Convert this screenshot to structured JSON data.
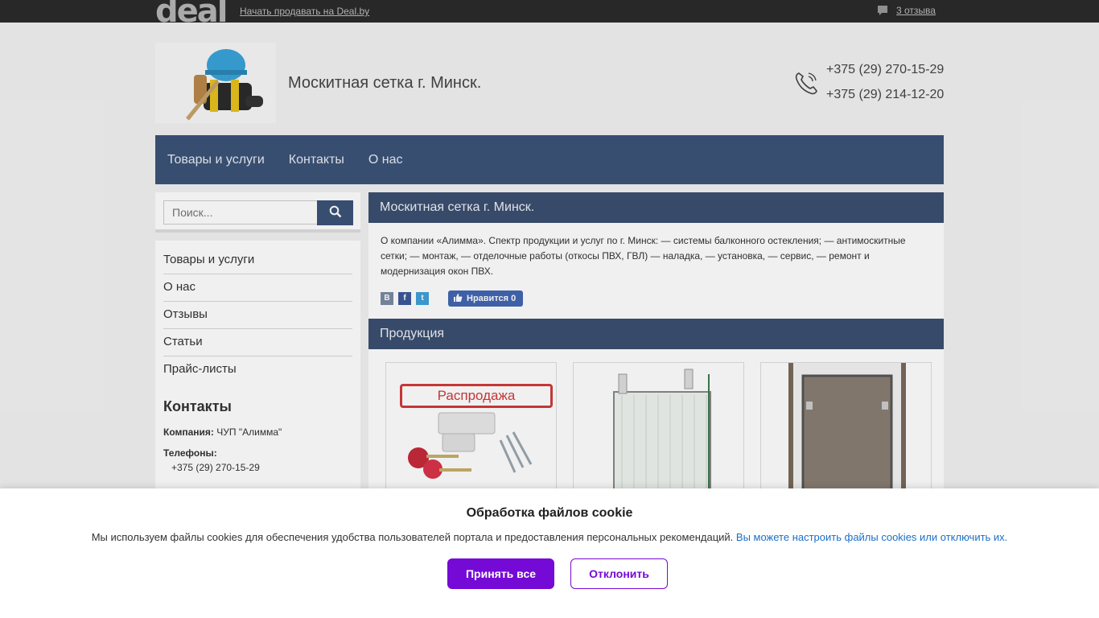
{
  "topbar": {
    "logo_text": "deal",
    "sell_link": "Начать продавать на Deal.by",
    "reviews_link": "3 отзыва"
  },
  "header": {
    "title": "Москитная сетка г. Минск.",
    "phones": [
      "+375 (29) 270-15-29",
      "+375 (29) 214-12-20"
    ]
  },
  "nav": {
    "items": [
      "Товары и услуги",
      "Контакты",
      "О нас"
    ]
  },
  "search": {
    "placeholder": "Поиск..."
  },
  "sidebar": {
    "menu": [
      "Товары и услуги",
      "О нас",
      "Отзывы",
      "Статьи",
      "Прайс-листы"
    ],
    "contacts_heading": "Контакты",
    "company_label": "Компания:",
    "company_value": "ЧУП \"Алимма\"",
    "phones_label": "Телефоны:",
    "phones_value": "+375 (29) 270-15-29"
  },
  "main": {
    "section_title": "Москитная сетка г. Минск.",
    "about": "О компании «Алимма». Спектр продукции и услуг по г. Минск: — системы балконного остекления; — антимоскитные сетки; — монтаж, — отделочные работы (откосы ПВХ, ГВЛ) — наладка, — установка, — сервис, — ремонт и модернизация окон ПВХ.",
    "social": {
      "vk": "B",
      "fb": "f",
      "tw": "t"
    },
    "like_label": "Нравится 0",
    "products_title": "Продукция",
    "product1_label": "Распродажа"
  },
  "cookie": {
    "title": "Обработка файлов cookie",
    "text": "Мы используем файлы cookies для обеспечения удобства пользователей портала и предоставления персональных рекомендаций.",
    "link": "Вы можете настроить файлы cookies или отключить их.",
    "accept": "Принять все",
    "decline": "Отклонить"
  },
  "colors": {
    "nav_bg": "#3b5378",
    "section_head_bg": "#3b4f70",
    "accent_purple": "#7509d6",
    "link_blue": "#1a6fc9"
  }
}
